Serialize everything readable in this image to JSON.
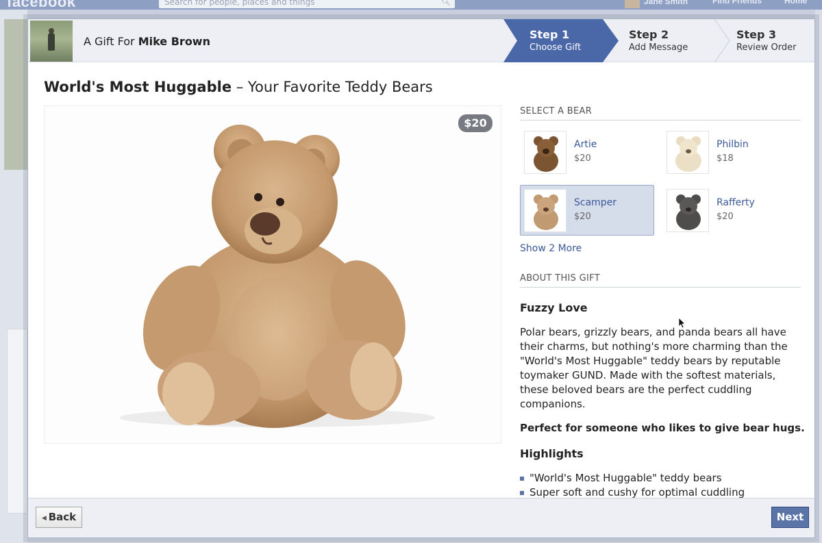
{
  "fb": {
    "logo": "facebook",
    "search_placeholder": "Search for people, places and things",
    "user_name": "Jane Smith",
    "nav": [
      "Find Friends",
      "Home"
    ]
  },
  "dialog": {
    "gift_for_prefix": "A Gift For",
    "recipient_name": "Mike Brown",
    "steps": [
      {
        "number": "Step 1",
        "label": "Choose Gift",
        "active": true
      },
      {
        "number": "Step 2",
        "label": "Add Message",
        "active": false
      },
      {
        "number": "Step 3",
        "label": "Review Order",
        "active": false
      }
    ],
    "product": {
      "title_bold": "World's Most Huggable",
      "title_rest": " – Your Favorite Teddy Bears",
      "price": "$20"
    },
    "select_heading": "SELECT A BEAR",
    "bears": [
      {
        "name": "Artie",
        "price": "$20",
        "color": "#7b5431"
      },
      {
        "name": "Philbin",
        "price": "$18",
        "color": "#e9dcc0"
      },
      {
        "name": "Scamper",
        "price": "$20",
        "color": "#c19a72"
      },
      {
        "name": "Rafferty",
        "price": "$20",
        "color": "#4f4c4c"
      }
    ],
    "selected_bear": "Scamper",
    "show_more": "Show 2 More",
    "about_heading": "ABOUT THIS GIFT",
    "about_title": "Fuzzy Love",
    "about_text": "Polar bears, grizzly bears, and panda bears all have their charms, but nothing's more charming than the \"World's Most Huggable\" teddy bears by reputable toymaker GUND. Made with the softest materials, these beloved bears are the perfect cuddling companions.",
    "about_tagline": "Perfect for someone who likes to give bear hugs.",
    "highlights_title": "Highlights",
    "highlights": [
      "\"World's Most Huggable\" teddy bears",
      "Super soft and cushy for optimal cuddling"
    ],
    "back_label": "Back",
    "next_label": "Next"
  },
  "colors": {
    "accent": "#4a67a8",
    "link": "#3b5998",
    "button_primary": "#5b74a8"
  }
}
